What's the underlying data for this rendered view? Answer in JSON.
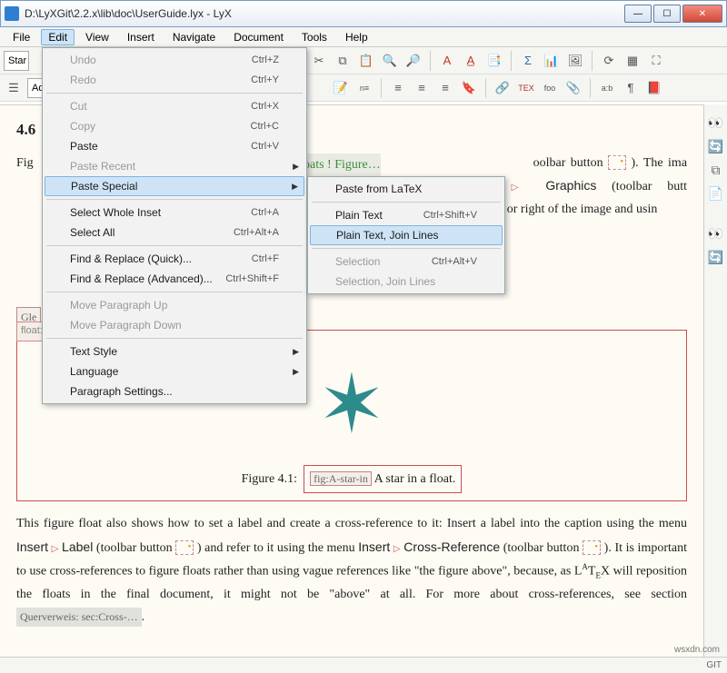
{
  "window": {
    "title": "D:\\LyXGit\\2.2.x\\lib\\doc\\UserGuide.lyx - LyX"
  },
  "menubar": [
    "File",
    "Edit",
    "View",
    "Insert",
    "Navigate",
    "Document",
    "Tools",
    "Help"
  ],
  "toolbar1": {
    "combo": "Star"
  },
  "toolbar2": {
    "combo": "Addi"
  },
  "editmenu": {
    "undo": "Undo",
    "undo_s": "Ctrl+Z",
    "redo": "Redo",
    "redo_s": "Ctrl+Y",
    "cut": "Cut",
    "cut_s": "Ctrl+X",
    "copy": "Copy",
    "copy_s": "Ctrl+C",
    "paste": "Paste",
    "paste_s": "Ctrl+V",
    "pasterecent": "Paste Recent",
    "pastespecial": "Paste Special",
    "selwhole": "Select Whole Inset",
    "selwhole_s": "Ctrl+A",
    "selall": "Select All",
    "selall_s": "Ctrl+Alt+A",
    "findq": "Find & Replace (Quick)...",
    "findq_s": "Ctrl+F",
    "finda": "Find & Replace (Advanced)...",
    "finda_s": "Ctrl+Shift+F",
    "moveup": "Move Paragraph Up",
    "movedown": "Move Paragraph Down",
    "textstyle": "Text Style",
    "language": "Language",
    "parset": "Paragraph Settings..."
  },
  "submenu": {
    "pflatex": "Paste from LaTeX",
    "plain": "Plain Text",
    "plain_s": "Ctrl+Shift+V",
    "plainjoin": "Plain Text, Join Lines",
    "selection": "Selection",
    "selection_s": "Ctrl+Alt+V",
    "seljoin": "Selection, Join Lines"
  },
  "doc": {
    "heading_partial": "4.6",
    "gleit": "Gle",
    "floatfig": "oats ! Figure…",
    "p1a": "Fig",
    "p1b": "oolbar button ",
    "p1c": "). The ima",
    "insert": "Insert",
    "graphics": "Graphics",
    "p1d": " (toolbar butt",
    "p1e": "eft or right of the image and usin",
    "figcap_num": "Figure 4.1:",
    "figcap_label": "fig:A-star-in",
    "figcap_text": "A star in a float.",
    "p2a": "This figure float also shows how to set a label and create a cross-reference to it: Insert a label into the caption using the menu ",
    "label": "Label",
    "p2b": " (toolbar button ",
    "p2c": ") and refer to it using the menu ",
    "crossref": "Cross-Reference",
    "p2d": " (toolbar button ",
    "p2e": "). It is important to use cross-references to figure floats rather than using vague references like \"the figure above\", because, as L",
    "latex_a": "A",
    "p2f": "T",
    "latex_e": "E",
    "p2g": "X will reposition the floats in the final document, it might not be \"above\" at all. For more about cross-references, see section",
    "qref": "Querverweis: sec:Cross-…",
    "period": "."
  },
  "status": {
    "git": "GIT"
  },
  "watermark": "wsxdn.com"
}
